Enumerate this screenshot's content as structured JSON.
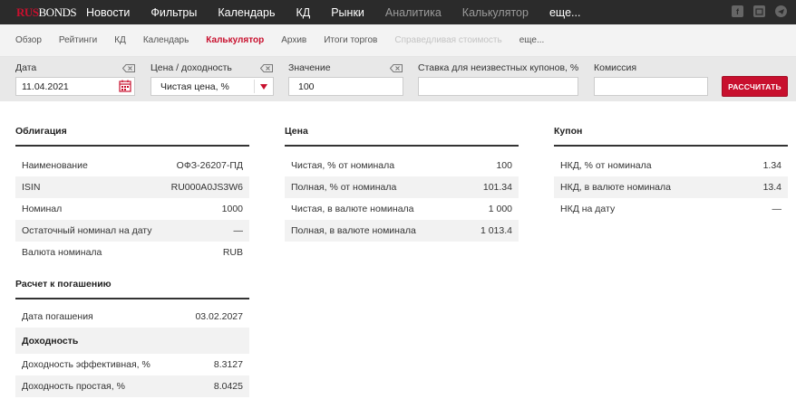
{
  "logo": {
    "rus": "RUS",
    "bonds": "BONDS"
  },
  "topnav": {
    "items": [
      "Новости",
      "Фильтры",
      "Календарь",
      "КД",
      "Рынки",
      "Аналитика",
      "Калькулятор",
      "еще..."
    ],
    "icons": [
      "facebook-icon",
      "vk-icon",
      "telegram-icon"
    ]
  },
  "subnav": {
    "items": [
      "Обзор",
      "Рейтинги",
      "КД",
      "Календарь",
      "Калькулятор",
      "Архив",
      "Итоги торгов",
      "Справедливая стоимость",
      "еще..."
    ],
    "active": "Калькулятор"
  },
  "form": {
    "date_label": "Дата",
    "date_value": "11.04.2021",
    "price_label": "Цена / доходность",
    "price_value": "Чистая цена, %",
    "value_label": "Значение",
    "value_value": "100",
    "rate_label": "Ставка для неизвестных купонов, %",
    "rate_value": "",
    "fee_label": "Комиссия",
    "fee_value": "",
    "calc_button": "РАССЧИТАТЬ"
  },
  "bond": {
    "title": "Облигация",
    "rows": [
      {
        "label": "Наименование",
        "value": "ОФЗ-26207-ПД"
      },
      {
        "label": "ISIN",
        "value": "RU000A0JS3W6"
      },
      {
        "label": "Номинал",
        "value": "1000"
      },
      {
        "label": "Остаточный номинал на дату",
        "value": "—"
      },
      {
        "label": "Валюта номинала",
        "value": "RUB"
      }
    ]
  },
  "maturity": {
    "title": "Расчет к погашению",
    "rows": [
      {
        "label": "Дата погашения",
        "value": "03.02.2027"
      },
      {
        "label": "Доходность",
        "value": ""
      },
      {
        "label": "Доходность эффективная, %",
        "value": "8.3127"
      },
      {
        "label": "Доходность простая, %",
        "value": "8.0425"
      }
    ]
  },
  "price": {
    "title": "Цена",
    "rows": [
      {
        "label": "Чистая, % от номинала",
        "value": "100"
      },
      {
        "label": "Полная, % от номинала",
        "value": "101.34"
      },
      {
        "label": "Чистая, в валюте номинала",
        "value": "1 000"
      },
      {
        "label": "Полная, в валюте номинала",
        "value": "1 013.4"
      }
    ]
  },
  "coupon": {
    "title": "Купон",
    "rows": [
      {
        "label": "НКД, % от номинала",
        "value": "1.34"
      },
      {
        "label": "НКД, в валюте номинала",
        "value": "13.4"
      },
      {
        "label": "НКД на дату",
        "value": "—"
      }
    ]
  },
  "colors": {
    "accent": "#c8102e",
    "topbar": "#2b2b2b",
    "form_bg": "#e8e8e8"
  }
}
